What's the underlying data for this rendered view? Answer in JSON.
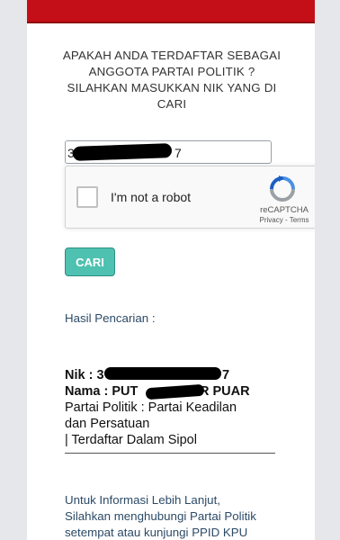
{
  "header": {
    "brand_color": "#c40f18"
  },
  "question": {
    "line1": "APAKAH ANDA TERDAFTAR SEBAGAI",
    "line2": "ANGGOTA PARTAI POLITIK ?",
    "line3": "SILAHKAN MASUKKAN NIK YANG DI",
    "line4": "CARI"
  },
  "nik_field": {
    "value_start": "3",
    "value_end": "7"
  },
  "recaptcha": {
    "label": "I'm not a robot",
    "brand": "reCAPTCHA",
    "links": "Privacy - Terms"
  },
  "search_button": {
    "label": "CARI",
    "color": "#4fc1b0"
  },
  "results": {
    "heading": "Hasil Pencarian :",
    "nik_label": "Nik : 3",
    "nik_end": "7",
    "nama_label": "Nama : PUT",
    "nama_end": "R PUAR",
    "partai_line1": "Partai Politik : Partai Keadilan",
    "partai_line2": "dan Persatuan",
    "status": "| Terdaftar Dalam Sipol"
  },
  "info": {
    "line1": "Untuk Informasi Lebih Lanjut,",
    "line2": "Silahkan menghubungi Partai Politik",
    "line3": "setempat atau kunjungi PPID KPU"
  }
}
